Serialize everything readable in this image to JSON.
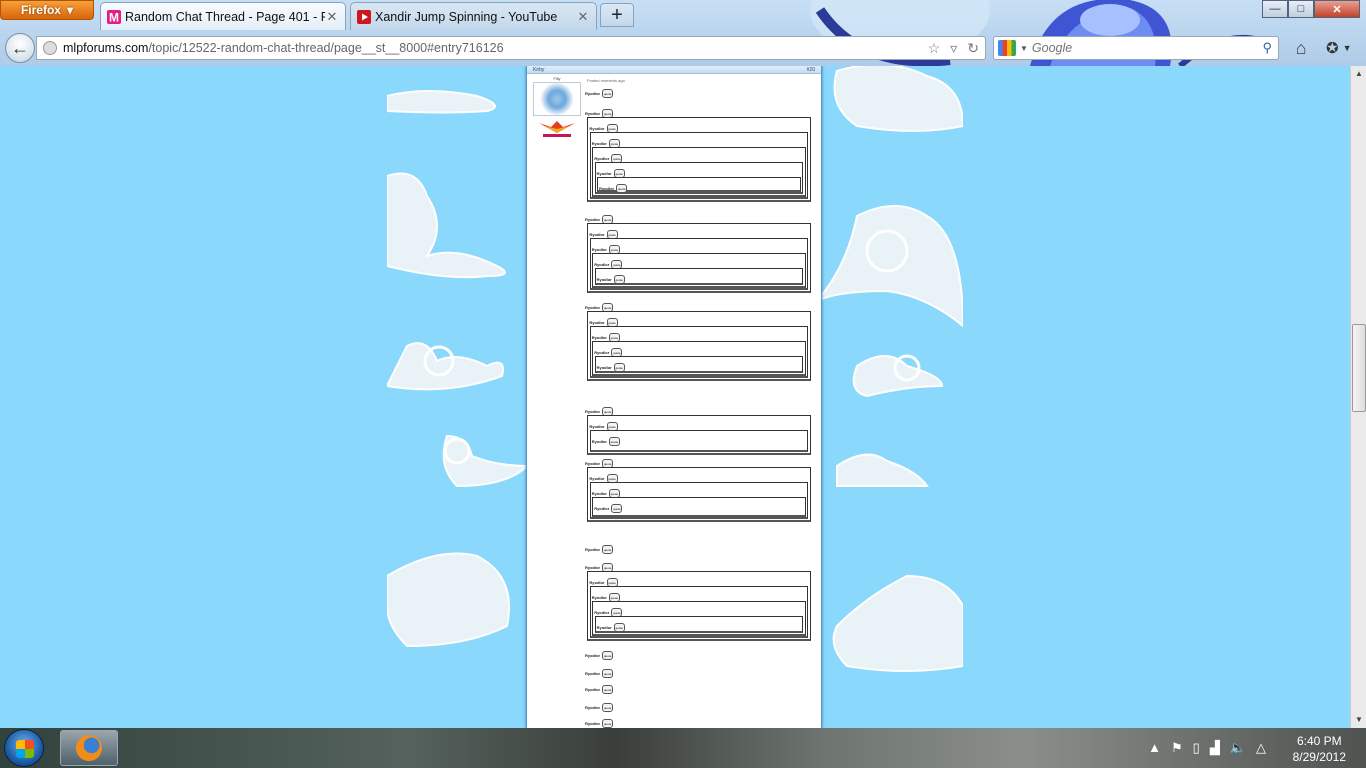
{
  "browser": {
    "menu_label": "Firefox",
    "tabs": [
      {
        "title": "Random Chat Thread - Page 401 - Fo...",
        "active": true,
        "favicon": "mlp-forums-icon",
        "color": "#e31f83"
      },
      {
        "title": "Xandir Jump Spinning - YouTube",
        "active": false,
        "favicon": "youtube-icon",
        "color": "#cc181e"
      }
    ],
    "new_tab": "+",
    "window_controls": {
      "minimize": "—",
      "maximize": "□",
      "close": "✕"
    },
    "url": {
      "domain": "mlpforums.com",
      "path": "/topic/12522-random-chat-thread/page__st__8000#entry716126"
    },
    "search": {
      "placeholder": "Google"
    }
  },
  "post": {
    "author": "Kirby",
    "post_number": "#20",
    "group": "Filly",
    "posted": "Posted moments ago",
    "quote_name": "Ryodlor",
    "quote_button": "quote"
  },
  "taskbar": {
    "time": "6:40 PM",
    "date": "8/29/2012"
  }
}
